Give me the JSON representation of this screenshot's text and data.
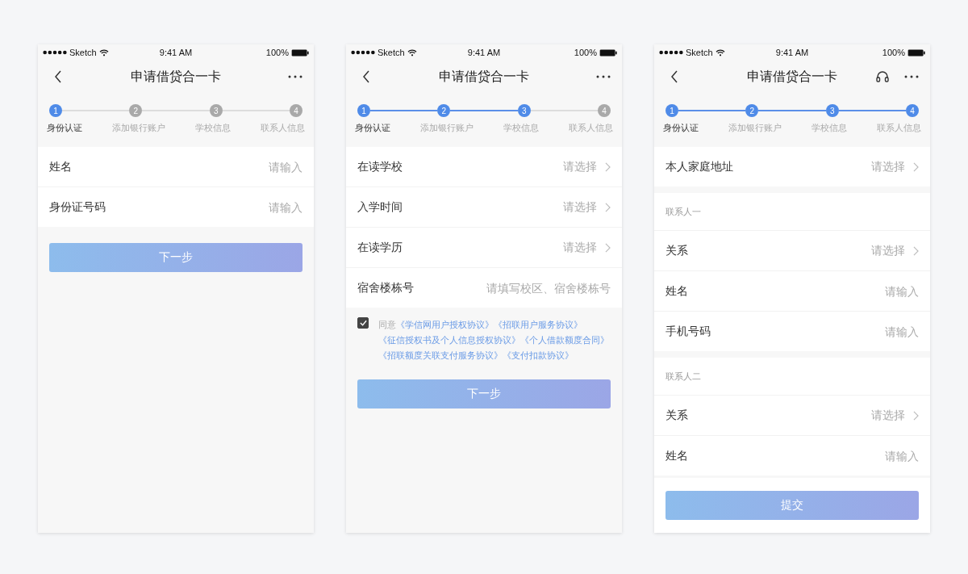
{
  "phones": [
    {
      "status_bar": {
        "carrier": "Sketch",
        "time": "9:41 AM",
        "battery": "100%"
      },
      "title": "申请借贷合一卡",
      "support": false,
      "steps": [
        {
          "number": "1",
          "label": "身份认证",
          "completed": true,
          "current": true
        },
        {
          "number": "2",
          "label": "添加银行账户",
          "completed": false,
          "current": false
        },
        {
          "number": "3",
          "label": "学校信息",
          "completed": false,
          "current": false
        },
        {
          "number": "4",
          "label": "联系人信息",
          "completed": false,
          "current": false
        }
      ],
      "sections": [
        {
          "rows": [
            {
              "kind": "input",
              "label": "姓名",
              "placeholder": "请输入"
            },
            {
              "kind": "input",
              "label": "身份证号码",
              "placeholder": "请输入"
            }
          ]
        }
      ],
      "button": {
        "label": "下一步",
        "disabled": true
      }
    },
    {
      "status_bar": {
        "carrier": "Sketch",
        "time": "9:41 AM",
        "battery": "100%"
      },
      "title": "申请借贷合一卡",
      "support": false,
      "steps": [
        {
          "number": "1",
          "label": "身份认证",
          "completed": true,
          "current": true
        },
        {
          "number": "2",
          "label": "添加银行账户",
          "completed": true,
          "current": false
        },
        {
          "number": "3",
          "label": "学校信息",
          "completed": true,
          "current": false
        },
        {
          "number": "4",
          "label": "联系人信息",
          "completed": false,
          "current": false
        }
      ],
      "sections": [
        {
          "rows": [
            {
              "kind": "select",
              "label": "在读学校",
              "placeholder": "请选择"
            },
            {
              "kind": "select",
              "label": "入学时间",
              "placeholder": "请选择"
            },
            {
              "kind": "select",
              "label": "在读学历",
              "placeholder": "请选择"
            },
            {
              "kind": "input",
              "label": "宿舍楼栋号",
              "placeholder": "请填写校区、宿舍楼栋号"
            }
          ]
        }
      ],
      "agreement": {
        "checked": true,
        "prefix": "同意",
        "links": [
          "《学信网用户授权协议》",
          "《招联用户服务协议》",
          "《征信授权书及个人信息授权协议》",
          "《个人借款额度合同》",
          "《招联额度关联支付服务协议》",
          "《支付扣款协议》"
        ]
      },
      "button": {
        "label": "下一步",
        "disabled": true
      }
    },
    {
      "status_bar": {
        "carrier": "Sketch",
        "time": "9:41 AM",
        "battery": "100%"
      },
      "title": "申请借贷合一卡",
      "support": true,
      "steps": [
        {
          "number": "1",
          "label": "身份认证",
          "completed": true,
          "current": true
        },
        {
          "number": "2",
          "label": "添加银行账户",
          "completed": true,
          "current": false
        },
        {
          "number": "3",
          "label": "学校信息",
          "completed": true,
          "current": false
        },
        {
          "number": "4",
          "label": "联系人信息",
          "completed": true,
          "current": false
        }
      ],
      "sections": [
        {
          "rows": [
            {
              "kind": "select",
              "label": "本人家庭地址",
              "placeholder": "请选择"
            }
          ]
        },
        {
          "header": "联系人一",
          "rows": [
            {
              "kind": "select",
              "label": "关系",
              "placeholder": "请选择"
            },
            {
              "kind": "input",
              "label": "姓名",
              "placeholder": "请输入"
            },
            {
              "kind": "input",
              "label": "手机号码",
              "placeholder": "请输入"
            }
          ]
        },
        {
          "header": "联系人二",
          "rows": [
            {
              "kind": "select",
              "label": "关系",
              "placeholder": "请选择"
            },
            {
              "kind": "input",
              "label": "姓名",
              "placeholder": "请输入"
            }
          ]
        }
      ],
      "button": {
        "label": "提交",
        "disabled": true
      }
    }
  ]
}
